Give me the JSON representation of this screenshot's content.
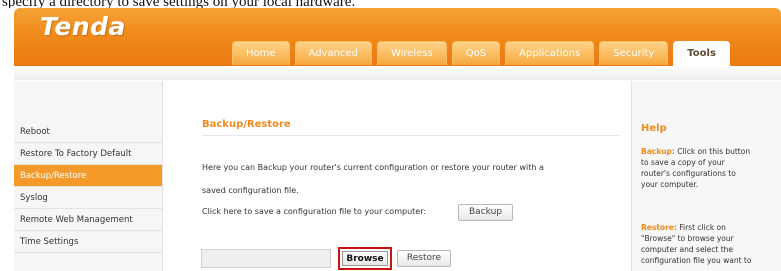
{
  "caption": "specify a directory to save settings on your local hardware.",
  "brand": {
    "logo": "Tenda",
    "accent": "#f08a1c",
    "active_side": "#f59a2a"
  },
  "nav": {
    "tabs": [
      {
        "label": "Home"
      },
      {
        "label": "Advanced"
      },
      {
        "label": "Wireless"
      },
      {
        "label": "QoS"
      },
      {
        "label": "Applications"
      },
      {
        "label": "Security"
      },
      {
        "label": "Tools",
        "active": true
      }
    ]
  },
  "sidebar": {
    "items": [
      {
        "label": "Reboot"
      },
      {
        "label": "Restore To Factory Default"
      },
      {
        "label": "Backup/Restore",
        "active": true
      },
      {
        "label": "Syslog"
      },
      {
        "label": "Remote Web Management"
      },
      {
        "label": "Time Settings"
      }
    ]
  },
  "main": {
    "title": "Backup/Restore",
    "intro_1": "Here you can Backup your router's current configuration or restore your router with a",
    "intro_2": "saved configuration file.",
    "backup_prompt": "Click here to save a configuration file to your computer:",
    "backup_button": "Backup",
    "file_value": "",
    "browse_button": "Browse",
    "restore_button": "Restore"
  },
  "help": {
    "title": "Help",
    "backup_key": "Backup:",
    "backup_l1": " Click on this button",
    "backup_l2": "to save a copy of your",
    "backup_l3": "router's configurations to",
    "backup_l4": "your computer.",
    "restore_key": "Restore:",
    "restore_l1": " First click on",
    "restore_l2": "\"Browse\" to browse your",
    "restore_l3": "computer and select the",
    "restore_l4": "configuration file you want to"
  }
}
